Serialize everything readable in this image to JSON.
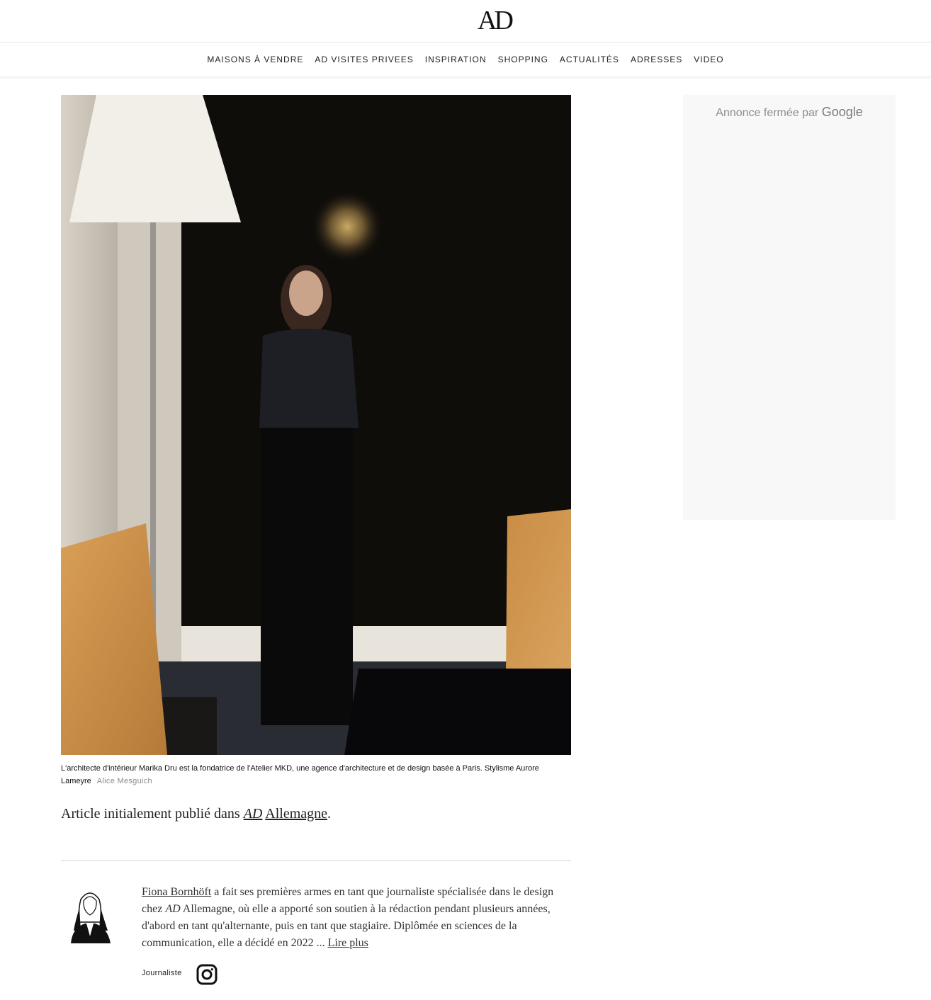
{
  "header": {
    "logo": "AD"
  },
  "nav": {
    "items": [
      "MAISONS À VENDRE",
      "AD VISITES PRIVEES",
      "INSPIRATION",
      "SHOPPING",
      "ACTUALITÉS",
      "ADRESSES",
      "VIDEO"
    ]
  },
  "article": {
    "image_caption": "L'architecte d'intérieur Marika Dru est la fondatrice de l'Atelier MKD, une agence d'architecture et de design basée à Paris. Stylisme Aurore Lameyre",
    "image_credit": "Alice Mesguich",
    "origin_prefix": "Article initialement publié dans ",
    "origin_ad": "AD",
    "origin_country": "Allemagne",
    "origin_suffix": "."
  },
  "author": {
    "name": "Fiona Bornhöft",
    "bio_part1": " a fait ses premières armes en tant que journaliste spécialisée dans le design chez ",
    "bio_ad": "AD",
    "bio_part2": " Allemagne, où elle a apporté son soutien à la rédaction pendant plusieurs années, d'abord en tant qu'alternante, puis en tant que stagiaire. Diplômée en sciences de la communication, elle a décidé en 2022 ... ",
    "read_more": "Lire plus",
    "role": "Journaliste",
    "social_icon": "instagram-icon"
  },
  "sidebar_ad": {
    "label": "Annonce fermée par ",
    "brand": "Google"
  }
}
